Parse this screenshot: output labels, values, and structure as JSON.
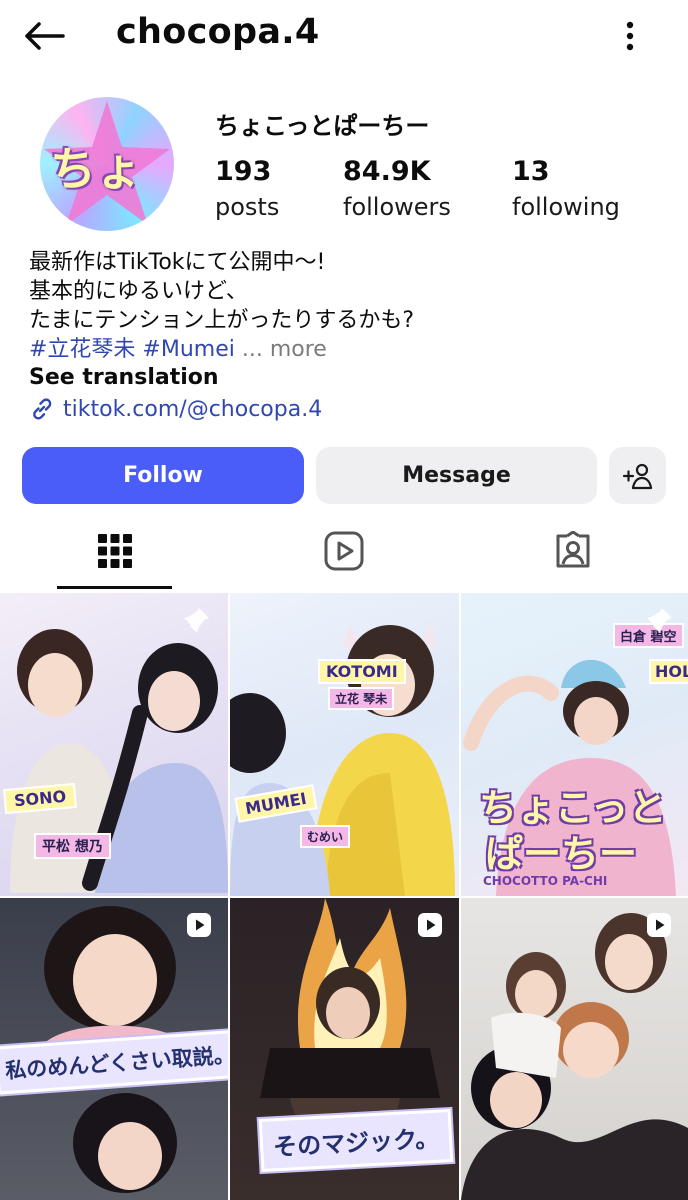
{
  "header": {
    "username": "chocopa.4"
  },
  "profile": {
    "avatar_text": "ちょ",
    "display_name": "ちょこっとぱーちー",
    "stats": [
      {
        "value": "193",
        "label": "posts"
      },
      {
        "value": "84.9K",
        "label": "followers"
      },
      {
        "value": "13",
        "label": "following"
      }
    ],
    "bio_lines": [
      "最新作はTikTokにて公開中〜!",
      "基本的にゆるいけど、",
      "たまにテンション上がったりするかも?"
    ],
    "hashtags": "#立花琴未 #Mumei",
    "more_label": "... more",
    "see_translation": "See translation",
    "link": "tiktok.com/@chocopa.4"
  },
  "actions": {
    "follow": "Follow",
    "message": "Message"
  },
  "tabs": [
    "grid-icon",
    "reels-icon",
    "tagged-icon"
  ],
  "posts": [
    {
      "type": "pinned",
      "labels": [
        "SONO",
        "平松 想乃"
      ]
    },
    {
      "type": "pinned",
      "labels": [
        "KOTOMI",
        "立花 琴未",
        "MUMEI",
        "むめい"
      ]
    },
    {
      "type": "pinned",
      "labels": [
        "白倉 碧空",
        "HOL",
        "ちょこっと",
        "ぱーちー",
        "CHOCOTTO PA-CHI"
      ]
    },
    {
      "type": "reel",
      "caption": "私のめんどくさい取説。"
    },
    {
      "type": "reel",
      "caption": "そのマジック。"
    },
    {
      "type": "reel",
      "caption": ""
    }
  ],
  "colors": {
    "follow_button": "#4a5df9",
    "link": "#3147b0",
    "secondary_button": "#efeff1"
  }
}
